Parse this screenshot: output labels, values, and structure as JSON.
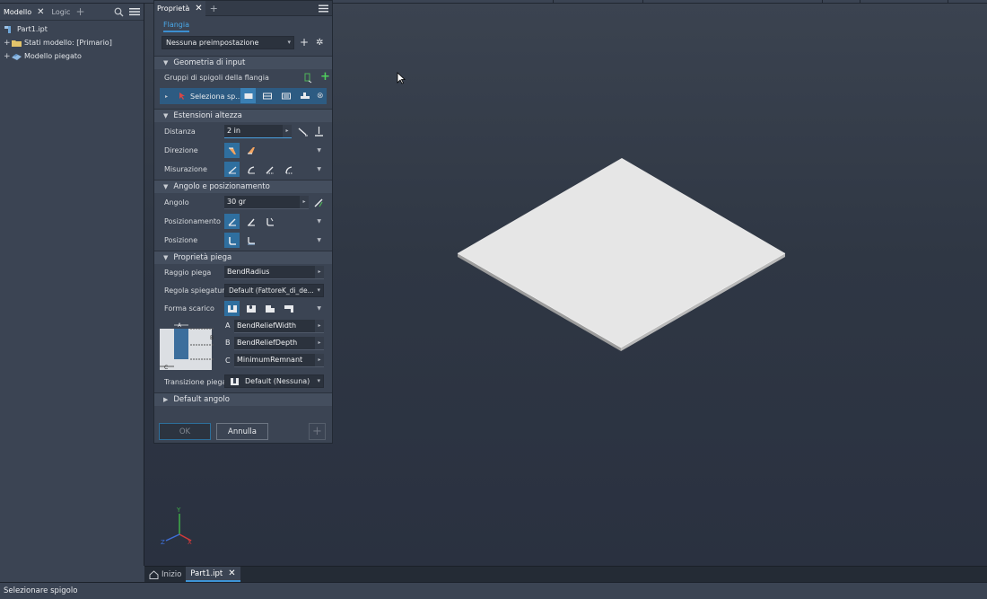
{
  "browser": {
    "tabs": [
      {
        "label": "Modello",
        "active": true
      },
      {
        "label": "Logic",
        "active": false
      }
    ],
    "tree": [
      {
        "label": "Part1.ipt",
        "expander": "",
        "icon": "part-icon"
      },
      {
        "label": "Stati modello: [Primario]",
        "expander": "+",
        "icon": "folder-icon"
      },
      {
        "label": "Modello piegato",
        "expander": "+",
        "icon": "flat-pattern-icon"
      }
    ]
  },
  "panel": {
    "tab_label": "Proprietà",
    "feature_tab": "Flangia",
    "preset": "Nessuna preimpostazione",
    "sections": {
      "input_geometry": "Geometria di input",
      "height_extents": "Estensioni altezza",
      "angle_positioning": "Angolo e posizionamento",
      "bend_properties": "Proprietà piega",
      "default_angle": "Default angolo"
    },
    "edge_groups_label": "Gruppi di spigoli della flangia",
    "select_label": "Seleziona sp...",
    "distance_label": "Distanza",
    "distance_value": "2 in",
    "direction_label": "Direzione",
    "measurement_label": "Misurazione",
    "angle_label": "Angolo",
    "angle_value": "30 gr",
    "positioning_label": "Posizionamento",
    "position_label": "Posizione",
    "bend_radius_label": "Raggio piega",
    "bend_radius_value": "BendRadius",
    "unfold_rule_label": "Regola spiegatura",
    "unfold_rule_value": "Default (FattoreK_di_de...",
    "relief_shape_label": "Forma scarico",
    "relief": {
      "a_letter": "A",
      "a_value": "BendReliefWidth",
      "b_letter": "B",
      "b_value": "BendReliefDepth",
      "c_letter": "C",
      "c_value": "MinimumRemnant"
    },
    "transition_label": "Transizione piega",
    "transition_value": "Default (Nessuna)",
    "ok_label": "OK",
    "cancel_label": "Annulla"
  },
  "doc_tabs": {
    "home": "Inizio",
    "part": "Part1.ipt"
  },
  "status": "Selezionare spigolo",
  "colors": {
    "accent": "#3d94d6",
    "panel_bg": "#3b4453",
    "viewport_bg": "#2f3744",
    "plate_top": "#e6e6e6"
  }
}
